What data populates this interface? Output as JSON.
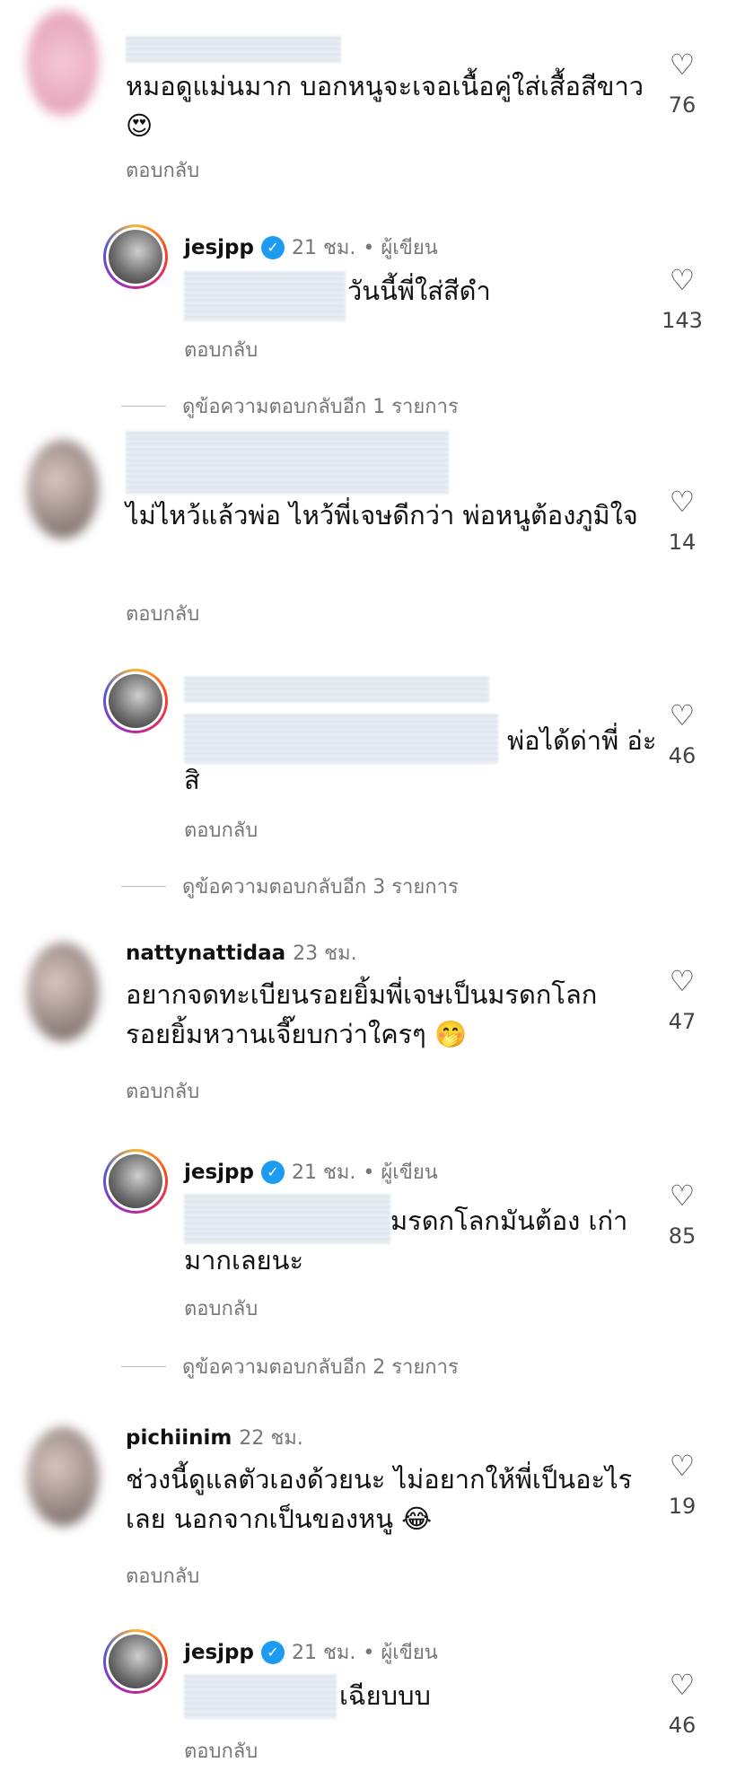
{
  "reply_label": "ตอบกลับ",
  "comments": [
    {
      "text": "หมอดูแม่นมาก บอกหนูจะเจอเนื้อคู่ใส่เสื้อสีขาว😍",
      "likes": "76"
    },
    {
      "user": "jesjpp",
      "time": "21 ชม.",
      "author": "• ผู้เขียน",
      "text": "วันนี้พี่ใส่สีดำ",
      "likes": "143",
      "more": "ดูข้อความตอบกลับอีก 1 รายการ"
    },
    {
      "text": "ไม่ไหว้แล้วพ่อ ไหว้พี่เจษดีกว่า พ่อหนูต้องภูมิใจ",
      "likes": "14"
    },
    {
      "text": "พ่อได้ด่าพี่ อ่ะสิ",
      "likes": "46",
      "more": "ดูข้อความตอบกลับอีก 3 รายการ"
    },
    {
      "user": "nattynattidaa",
      "time": "23 ชม.",
      "text": "อยากจดทะเบียนรอยยิ้มพี่เจษเป็นมรดกโลก รอยยิ้มหวานเจี๊ยบกว่าใครๆ 🤭",
      "likes": "47"
    },
    {
      "user": "jesjpp",
      "time": "21 ชม.",
      "author": "• ผู้เขียน",
      "text": "มรดกโลกมันต้อง เก่ามากเลยนะ",
      "likes": "85",
      "more": "ดูข้อความตอบกลับอีก 2 รายการ"
    },
    {
      "user": "pichiinim",
      "time": "22 ชม.",
      "text": "ช่วงนี้ดูแลตัวเองด้วยนะ ไม่อยากให้พี่เป็นอะไรเลย นอกจากเป็นของหนู 😂",
      "likes": "19"
    },
    {
      "user": "jesjpp",
      "time": "21 ชม.",
      "author": "• ผู้เขียน",
      "text": "เฉียบบบ",
      "likes": "46"
    }
  ]
}
